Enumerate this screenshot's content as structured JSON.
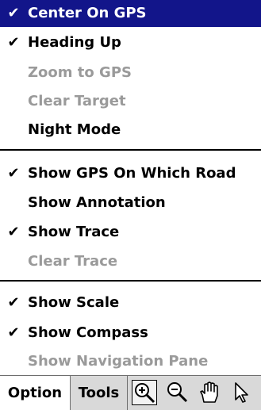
{
  "menu": {
    "items": [
      {
        "label": "Center On GPS",
        "check": "✔"
      },
      {
        "label": "Heading Up",
        "check": "✔"
      },
      {
        "label": "Zoom to GPS",
        "check": ""
      },
      {
        "label": "Clear Target",
        "check": ""
      },
      {
        "label": "Night Mode",
        "check": ""
      },
      {
        "label": "Show GPS On Which Road",
        "check": "✔"
      },
      {
        "label": "Show Annotation",
        "check": ""
      },
      {
        "label": "Show Trace",
        "check": "✔"
      },
      {
        "label": "Clear Trace",
        "check": ""
      },
      {
        "label": "Show Scale",
        "check": "✔"
      },
      {
        "label": "Show Compass",
        "check": "✔"
      },
      {
        "label": "Show Navigation Pane",
        "check": ""
      }
    ]
  },
  "toolbar": {
    "option_label": "Option",
    "tools_label": "Tools",
    "icons": [
      "zoom-in-icon",
      "zoom-out-icon",
      "pan-hand-icon",
      "pointer-icon"
    ]
  },
  "colors": {
    "highlight": "#12158a",
    "disabled_text": "#9a9a9a"
  }
}
